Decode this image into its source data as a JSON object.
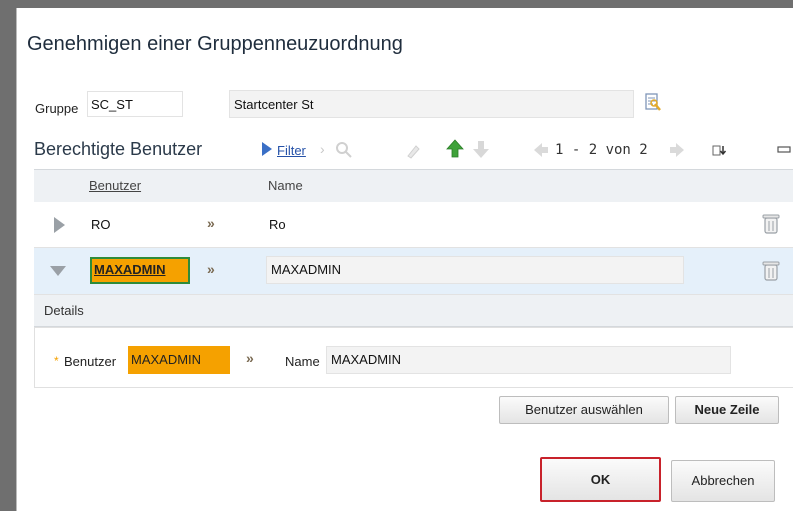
{
  "dialog": {
    "title": "Genehmigen einer Gruppenneuzuordnung",
    "gruppe_label": "Gruppe",
    "gruppe_value": "SC_ST",
    "gruppe_desc": "Startcenter St"
  },
  "section": {
    "title": "Berechtigte Benutzer",
    "filter_label": "Filter",
    "pager": "1 - 2 von 2"
  },
  "table": {
    "headers": [
      "Benutzer",
      "Name"
    ],
    "rows": [
      {
        "benutzer": "RO",
        "name": "Ro"
      },
      {
        "benutzer": "MAXADMIN",
        "name": "MAXADMIN"
      }
    ]
  },
  "details": {
    "title": "Details",
    "required_mark": "*",
    "benutzer_label": "Benutzer",
    "benutzer_value": "MAXADMIN",
    "name_label": "Name",
    "name_value": "MAXADMIN"
  },
  "buttons": {
    "select_user": "Benutzer auswählen",
    "new_row": "Neue Zeile",
    "ok": "OK",
    "cancel": "Abbrechen"
  },
  "colors": {
    "selection": "#f5a100",
    "primary_border": "#c8222b",
    "link": "#2652a8",
    "selected_row": "#e5f0fa"
  }
}
